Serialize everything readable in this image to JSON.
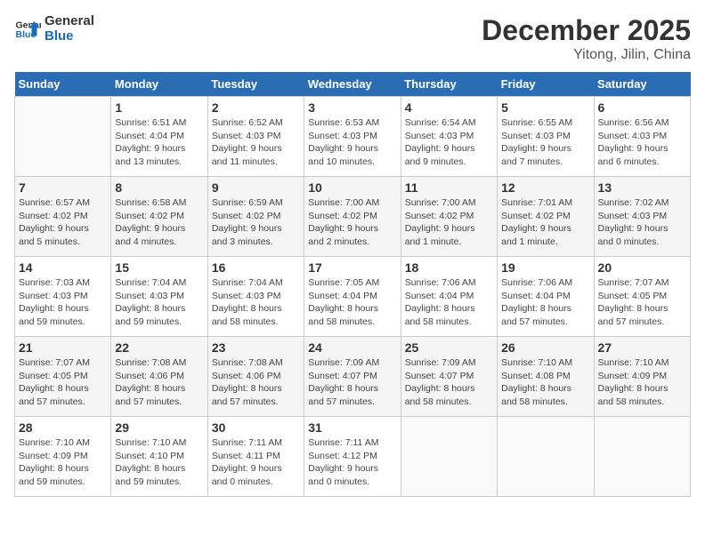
{
  "header": {
    "logo_line1": "General",
    "logo_line2": "Blue",
    "month": "December 2025",
    "location": "Yitong, Jilin, China"
  },
  "weekdays": [
    "Sunday",
    "Monday",
    "Tuesday",
    "Wednesday",
    "Thursday",
    "Friday",
    "Saturday"
  ],
  "weeks": [
    [
      {
        "day": "",
        "info": ""
      },
      {
        "day": "1",
        "info": "Sunrise: 6:51 AM\nSunset: 4:04 PM\nDaylight: 9 hours\nand 13 minutes."
      },
      {
        "day": "2",
        "info": "Sunrise: 6:52 AM\nSunset: 4:03 PM\nDaylight: 9 hours\nand 11 minutes."
      },
      {
        "day": "3",
        "info": "Sunrise: 6:53 AM\nSunset: 4:03 PM\nDaylight: 9 hours\nand 10 minutes."
      },
      {
        "day": "4",
        "info": "Sunrise: 6:54 AM\nSunset: 4:03 PM\nDaylight: 9 hours\nand 9 minutes."
      },
      {
        "day": "5",
        "info": "Sunrise: 6:55 AM\nSunset: 4:03 PM\nDaylight: 9 hours\nand 7 minutes."
      },
      {
        "day": "6",
        "info": "Sunrise: 6:56 AM\nSunset: 4:03 PM\nDaylight: 9 hours\nand 6 minutes."
      }
    ],
    [
      {
        "day": "7",
        "info": "Sunrise: 6:57 AM\nSunset: 4:02 PM\nDaylight: 9 hours\nand 5 minutes."
      },
      {
        "day": "8",
        "info": "Sunrise: 6:58 AM\nSunset: 4:02 PM\nDaylight: 9 hours\nand 4 minutes."
      },
      {
        "day": "9",
        "info": "Sunrise: 6:59 AM\nSunset: 4:02 PM\nDaylight: 9 hours\nand 3 minutes."
      },
      {
        "day": "10",
        "info": "Sunrise: 7:00 AM\nSunset: 4:02 PM\nDaylight: 9 hours\nand 2 minutes."
      },
      {
        "day": "11",
        "info": "Sunrise: 7:00 AM\nSunset: 4:02 PM\nDaylight: 9 hours\nand 1 minute."
      },
      {
        "day": "12",
        "info": "Sunrise: 7:01 AM\nSunset: 4:02 PM\nDaylight: 9 hours\nand 1 minute."
      },
      {
        "day": "13",
        "info": "Sunrise: 7:02 AM\nSunset: 4:03 PM\nDaylight: 9 hours\nand 0 minutes."
      }
    ],
    [
      {
        "day": "14",
        "info": "Sunrise: 7:03 AM\nSunset: 4:03 PM\nDaylight: 8 hours\nand 59 minutes."
      },
      {
        "day": "15",
        "info": "Sunrise: 7:04 AM\nSunset: 4:03 PM\nDaylight: 8 hours\nand 59 minutes."
      },
      {
        "day": "16",
        "info": "Sunrise: 7:04 AM\nSunset: 4:03 PM\nDaylight: 8 hours\nand 58 minutes."
      },
      {
        "day": "17",
        "info": "Sunrise: 7:05 AM\nSunset: 4:04 PM\nDaylight: 8 hours\nand 58 minutes."
      },
      {
        "day": "18",
        "info": "Sunrise: 7:06 AM\nSunset: 4:04 PM\nDaylight: 8 hours\nand 58 minutes."
      },
      {
        "day": "19",
        "info": "Sunrise: 7:06 AM\nSunset: 4:04 PM\nDaylight: 8 hours\nand 57 minutes."
      },
      {
        "day": "20",
        "info": "Sunrise: 7:07 AM\nSunset: 4:05 PM\nDaylight: 8 hours\nand 57 minutes."
      }
    ],
    [
      {
        "day": "21",
        "info": "Sunrise: 7:07 AM\nSunset: 4:05 PM\nDaylight: 8 hours\nand 57 minutes."
      },
      {
        "day": "22",
        "info": "Sunrise: 7:08 AM\nSunset: 4:06 PM\nDaylight: 8 hours\nand 57 minutes."
      },
      {
        "day": "23",
        "info": "Sunrise: 7:08 AM\nSunset: 4:06 PM\nDaylight: 8 hours\nand 57 minutes."
      },
      {
        "day": "24",
        "info": "Sunrise: 7:09 AM\nSunset: 4:07 PM\nDaylight: 8 hours\nand 57 minutes."
      },
      {
        "day": "25",
        "info": "Sunrise: 7:09 AM\nSunset: 4:07 PM\nDaylight: 8 hours\nand 58 minutes."
      },
      {
        "day": "26",
        "info": "Sunrise: 7:10 AM\nSunset: 4:08 PM\nDaylight: 8 hours\nand 58 minutes."
      },
      {
        "day": "27",
        "info": "Sunrise: 7:10 AM\nSunset: 4:09 PM\nDaylight: 8 hours\nand 58 minutes."
      }
    ],
    [
      {
        "day": "28",
        "info": "Sunrise: 7:10 AM\nSunset: 4:09 PM\nDaylight: 8 hours\nand 59 minutes."
      },
      {
        "day": "29",
        "info": "Sunrise: 7:10 AM\nSunset: 4:10 PM\nDaylight: 8 hours\nand 59 minutes."
      },
      {
        "day": "30",
        "info": "Sunrise: 7:11 AM\nSunset: 4:11 PM\nDaylight: 9 hours\nand 0 minutes."
      },
      {
        "day": "31",
        "info": "Sunrise: 7:11 AM\nSunset: 4:12 PM\nDaylight: 9 hours\nand 0 minutes."
      },
      {
        "day": "",
        "info": ""
      },
      {
        "day": "",
        "info": ""
      },
      {
        "day": "",
        "info": ""
      }
    ]
  ]
}
